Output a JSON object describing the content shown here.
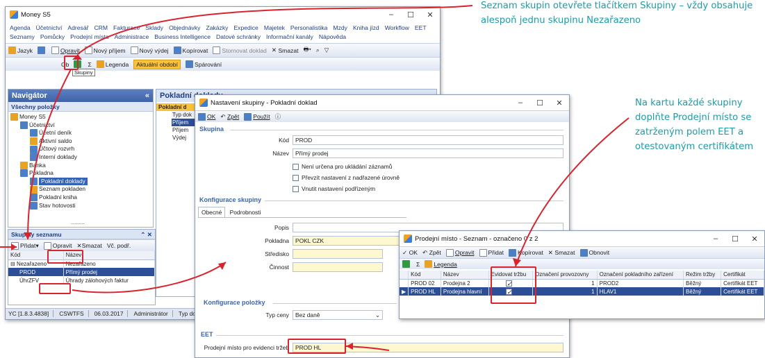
{
  "main": {
    "title": "Money S5",
    "menu": [
      "Agenda",
      "Účetnictví",
      "Adresář",
      "CRM",
      "Fakturace",
      "Sklady",
      "Objednávky",
      "Zakázky",
      "Expedice",
      "Majetek",
      "Personalistika",
      "Mzdy",
      "Kniha jízd",
      "Workflow",
      "EET",
      "Seznamy",
      "Pomůcky",
      "Prodejní místa",
      "Administrace",
      "Business Intelligence",
      "Datové schránky",
      "Informační kanály",
      "Nápověda"
    ],
    "toolbar1": {
      "jazyk": "Jazyk",
      "opravit": "Opravit",
      "novy_prijem": "Nový příjem",
      "novy_vydej": "Nový výdej",
      "kopirovat": "Kopírovat",
      "stornovat": "Stornovat doklad",
      "smazat": "Smazat"
    },
    "tooltip": "Skupiny",
    "toolbar2": {
      "legenda": "Legenda",
      "aktualni": "Aktuální období",
      "sparovani": "Spárování",
      "ob": "Ob"
    },
    "statusbar": [
      "YC [1.8.3.4838]",
      "CSWTFS",
      "06.03.2017",
      "Administrátor",
      "Typ dok"
    ]
  },
  "navigator": {
    "title": "Navigátor",
    "all": "Všechny položky",
    "tree": [
      "Money S5",
      "Účetnictví",
      "Účetní deník",
      "Aktivní saldo",
      "Účtový rozvrh",
      "Interní doklady",
      "Banka",
      "Pokladna",
      "Pokladní doklady",
      "Seznam pokladen",
      "Pokladní kniha",
      "Stav hotovosti"
    ],
    "dots": ".........."
  },
  "doclist": {
    "title": "Pokladní doklady",
    "tab": "Pokladní d",
    "col": "Typ dok",
    "rows": [
      "Příjem",
      "Příjem",
      "Výdej"
    ]
  },
  "groups": {
    "title": "Skupiny seznamu",
    "pridat": "Přidat",
    "opravit": "Opravit",
    "smazat": "Smazat",
    "vc": "Vč. podř.",
    "cols": [
      "Kód",
      "Název"
    ],
    "rows": [
      [
        "Nezařazeno",
        "Nezařazeno"
      ],
      [
        "PROD",
        "Přímý prodej"
      ],
      [
        "ÚhrZFV",
        "Úhrady zálohových faktur"
      ]
    ]
  },
  "dialog": {
    "title": "Nastavení skupiny - Pokladní doklad",
    "ok": "OK",
    "zpet": "Zpět",
    "pouzit": "Použít",
    "skupina": "Skupina",
    "kod_label": "Kód",
    "kod": "PROD",
    "nazev_label": "Název",
    "nazev": "Přímý prodej",
    "checks": [
      "Není určena pro ukládání záznamů",
      "Převzít nastavení z nadřazené úrovně",
      "Vnutit nastavení podřízeným"
    ],
    "konfig": "Konfigurace skupiny",
    "tabs": [
      "Obecné",
      "Podrobnosti"
    ],
    "popis_label": "Popis",
    "pokladna_label": "Pokladna",
    "pokladna": "POKL CZK",
    "stredisko_label": "Středisko",
    "cinnost_label": "Činnost",
    "konfig_pol": "Konfigurace položky",
    "typceny_label": "Typ ceny",
    "typceny": "Bez daně",
    "eet": "EET",
    "pm_label": "Prodejní místo pro evidenci tržeb",
    "pm": "PROD HL"
  },
  "pm": {
    "title": "Prodejní místo - Seznam - označeno 0 z 2",
    "toolbar": {
      "ok": "OK",
      "zpet": "Zpět",
      "opravit": "Opravit",
      "pridat": "Přidat",
      "kopirovat": "Kopírovat",
      "smazat": "Smazat",
      "obnovit": "Obnovit",
      "legenda": "Legenda"
    },
    "cols": [
      "Kód",
      "Název",
      "Evidovat tržbu",
      "Označení provozovny",
      "Označení pokladního zařízení",
      "Režim tržby",
      "Certifikát"
    ],
    "rows": [
      [
        "PROD 02",
        "Prodejna 2",
        "",
        "1",
        "PROD2",
        "Běžný",
        "Certifikát EET"
      ],
      [
        "PROD HL",
        "Prodejna hlavní",
        "",
        "1",
        "HLAV1",
        "Běžný",
        "Certifikát EET"
      ]
    ]
  },
  "notes": {
    "top": "Seznam skupin otevřete tlačítkem Skupiny – vždy obsahuje alespoň jednu skupinu Nezařazeno",
    "right": "Na kartu každé skupiny doplňte Prodejní místo se zatrženým polem EET a otestovaným certifikátem"
  },
  "colors": {
    "accent": "#3e63a8",
    "annotation": "#1a9ea8",
    "highlight": "#d9232d"
  }
}
